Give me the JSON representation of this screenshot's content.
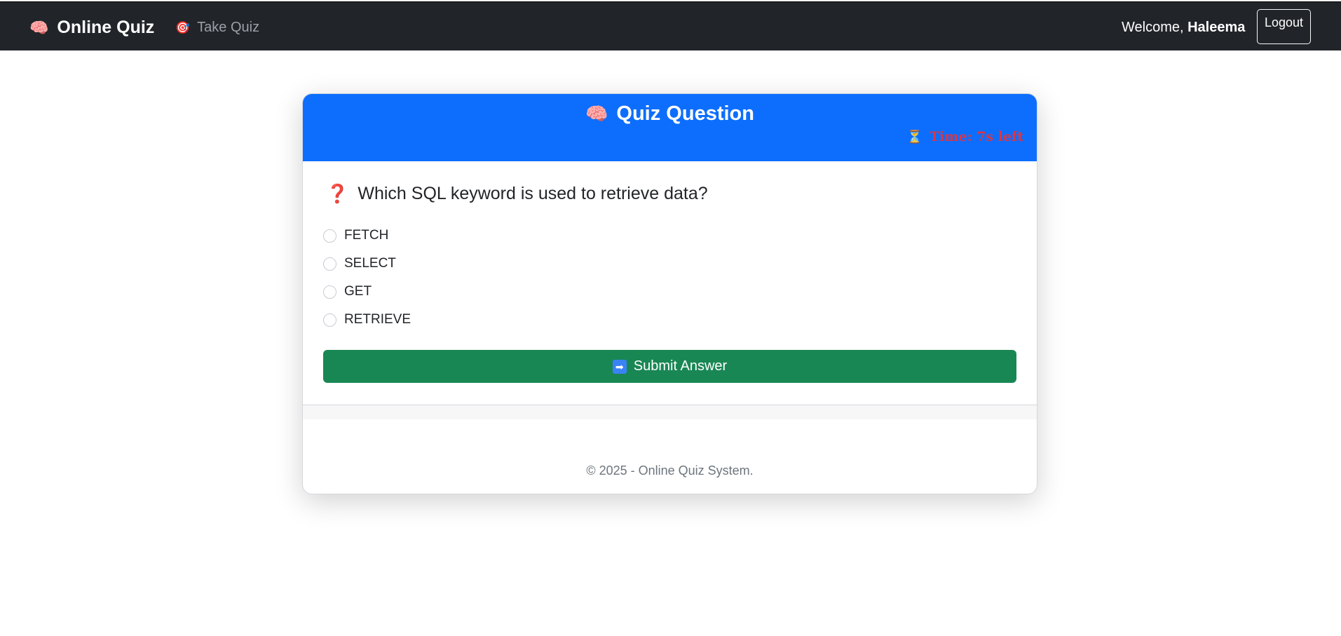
{
  "navbar": {
    "brand_icon": "brain-icon",
    "brand_emoji": "🧠",
    "brand_label": "Online Quiz",
    "link_icon": "target-icon",
    "link_emoji": "🎯",
    "link_label": "Take Quiz",
    "welcome_prefix": "Welcome, ",
    "username": "Haleema",
    "logout_label": "Logout"
  },
  "card": {
    "title_emoji": "🧠",
    "title": "Quiz Question",
    "timer_emoji": "⏳",
    "timer_text": "Time: 7s left",
    "question_emoji": "❓",
    "question": "Which SQL keyword is used to retrieve data?",
    "options": [
      "FETCH",
      "SELECT",
      "GET",
      "RETRIEVE"
    ],
    "submit_emoji": "➡",
    "submit_label": "Submit Answer",
    "copyright": "© 2025 - Online Quiz System."
  },
  "colors": {
    "navbar": "#212529",
    "header": "#0d6efd",
    "submit": "#198754",
    "timer": "#dc3545"
  }
}
